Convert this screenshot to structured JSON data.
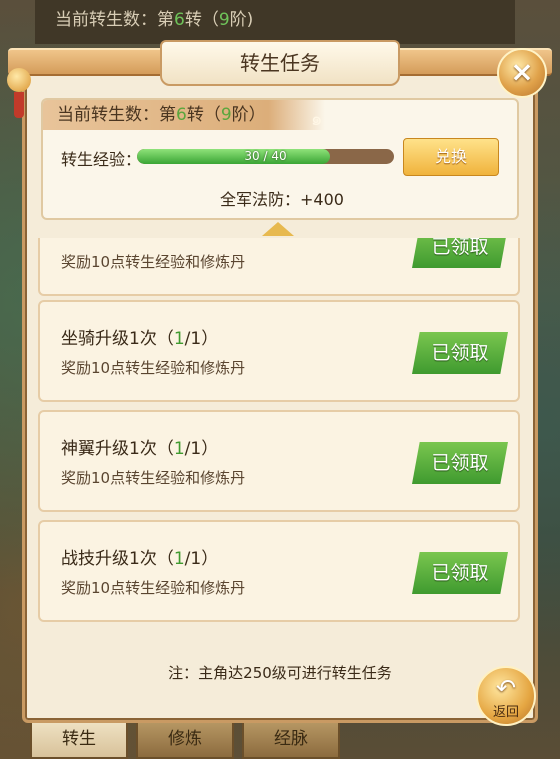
{
  "background": {
    "top_status": {
      "prefix": "当前转生数：第",
      "num": "6",
      "suffix": "转（",
      "stage": "9",
      "end": "阶)"
    },
    "bottom_tabs": [
      "转生",
      "修炼",
      "经脉"
    ]
  },
  "panel": {
    "title": "转生任务",
    "close_label": "×",
    "status": {
      "head_prefix": "当前转生数：第",
      "head_num": "6",
      "head_mid": "转（",
      "head_stage": "9",
      "head_end": "阶）",
      "exp_label": "转生经验：",
      "exp_text": "30 / 40",
      "exp_fraction": 0.75,
      "exchange_label": "兑换",
      "defense": "全军法防：+400"
    },
    "tasks": [
      {
        "name": "",
        "progress_pre": "",
        "progress_num": "",
        "progress_post": "",
        "desc": "奖励10点转生经验和修炼丹",
        "status": "已领取"
      },
      {
        "name": "坐骑升级1次",
        "progress_pre": "（",
        "progress_num": "1",
        "progress_post": "/1）",
        "desc": "奖励10点转生经验和修炼丹",
        "status": "已领取"
      },
      {
        "name": "神翼升级1次",
        "progress_pre": "（",
        "progress_num": "1",
        "progress_post": "/1）",
        "desc": "奖励10点转生经验和修炼丹",
        "status": "已领取"
      },
      {
        "name": "战技升级1次",
        "progress_pre": "（",
        "progress_num": "1",
        "progress_post": "/1）",
        "desc": "奖励10点转生经验和修炼丹",
        "status": "已领取"
      }
    ],
    "note": "注：主角达250级可进行转生任务",
    "back_label": "返回"
  },
  "colors": {
    "accent_green": "#3f9a2f",
    "panel_bg": "#f5ecd9",
    "gold": "#e7b94f"
  }
}
